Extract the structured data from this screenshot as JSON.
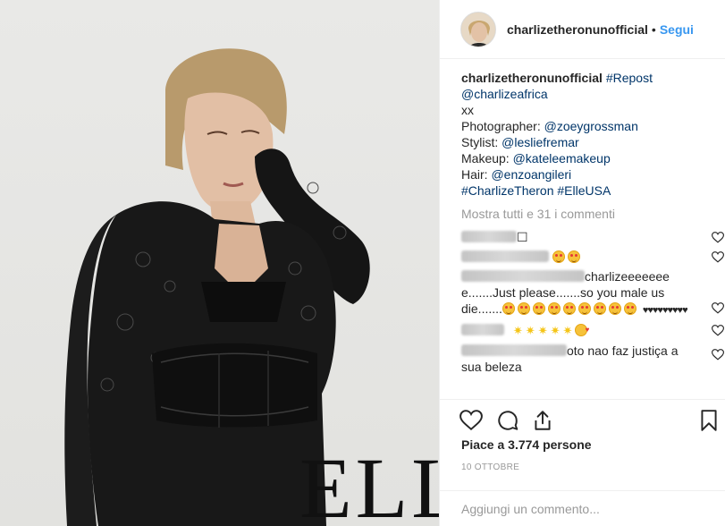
{
  "post": {
    "image_watermark": "ELLE"
  },
  "header": {
    "username": "charlizetheronunofficial",
    "separator": "•",
    "follow_label": "Segui"
  },
  "caption": {
    "username": "charlizetheronunofficial",
    "lines": [
      {
        "prefix": "",
        "tag": "#Repost"
      },
      {
        "prefix": "",
        "tag": "@charlizeafrica"
      },
      {
        "prefix": "xx",
        "tag": ""
      },
      {
        "prefix": "Photographer: ",
        "tag": "@zoeygrossman"
      },
      {
        "prefix": "Stylist: ",
        "tag": "@lesliefremar"
      },
      {
        "prefix": "Makeup: ",
        "tag": "@kateleemakeup"
      },
      {
        "prefix": "Hair: ",
        "tag": "@enzoangileri"
      },
      {
        "prefix": "",
        "tag": "#CharlizeTheron #ElleUSA"
      }
    ]
  },
  "view_all_comments": "Mostra tutti e 31 i commenti",
  "comments": [
    {
      "text": "☐"
    },
    {
      "text": ""
    },
    {
      "text": "charlizeeeeeee e.......Just please.......so you male us die.......",
      "hearts_text": "♥♥♥♥♥♥♥♥♥"
    },
    {
      "text": ""
    },
    {
      "text": "oto nao faz justiça a sua beleza"
    }
  ],
  "likes_text": "Piace a 3.774 persone",
  "date_text": "10 OTTOBRE",
  "add_comment_placeholder": "Aggiungi un commento...",
  "colors": {
    "link": "#003569",
    "follow": "#3897f0",
    "muted": "#999999",
    "border": "#efefef"
  }
}
